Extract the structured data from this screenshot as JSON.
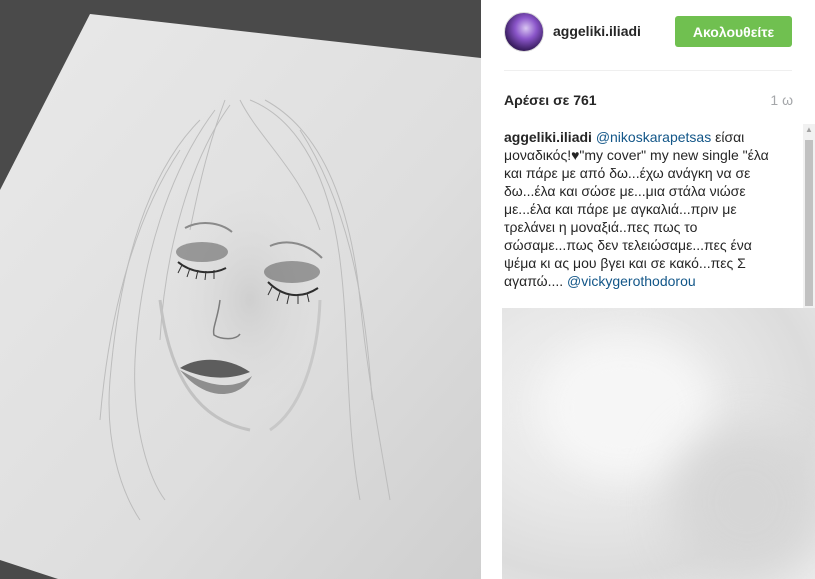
{
  "post": {
    "image_description_icon": "pencil-drawing-photo"
  },
  "header": {
    "username": "aggeliki.iliadi",
    "follow_label": "Ακολουθείτε"
  },
  "stats": {
    "likes": "Αρέσει σε 761",
    "time": "1 ω"
  },
  "caption": {
    "user": "aggeliki.iliadi",
    "mention1": "@nikoskarapetsas",
    "text": " είσαι μοναδικός!♥\"my cover\" my new single \"έλα και πάρε με από δω...έχω ανάγκη να σε δω...έλα και σώσε με...μια στάλα νιώσε με...έλα και πάρε με αγκαλιά...πριν με τρελάνει η μοναξιά..πες πως το σώσαμε...πως δεν τελειώσαμε...πες ένα ψέμα κι ας μου βγει και σε κακό...πες Σ αγαπώ....",
    "mention2": "@vickygerothodorou"
  },
  "colors": {
    "follow_green": "#70c050",
    "mention_blue": "#125688"
  }
}
